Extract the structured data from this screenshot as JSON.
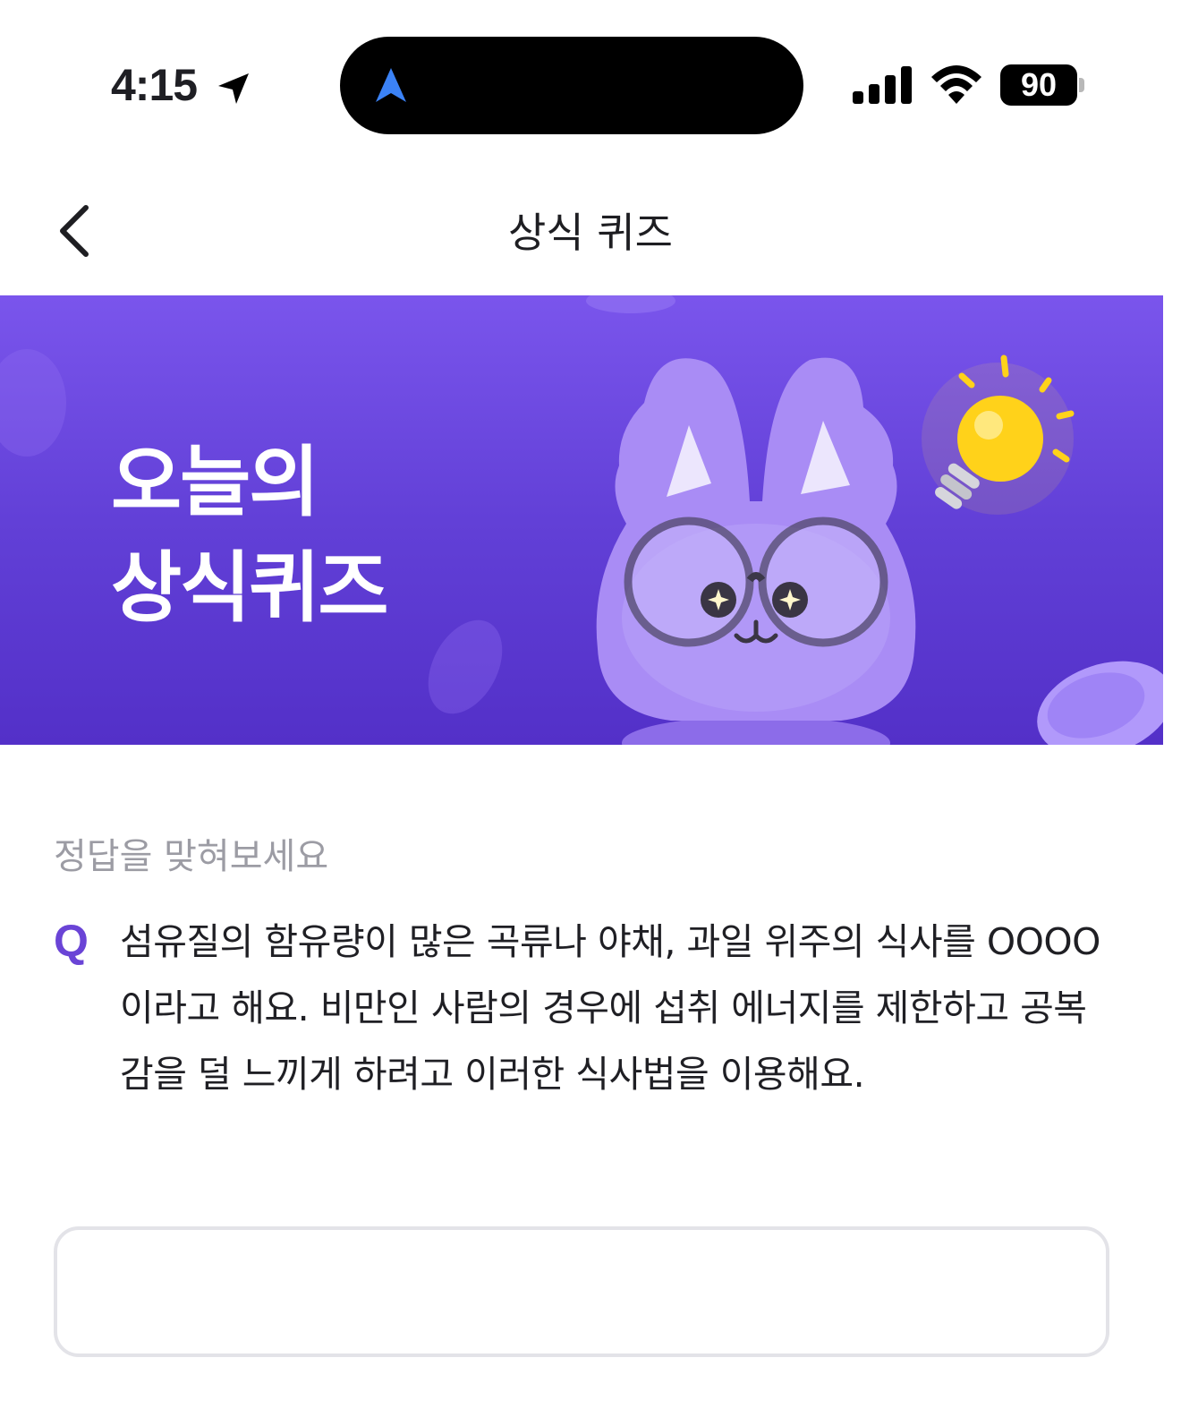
{
  "status_bar": {
    "time": "4:15",
    "battery": "90"
  },
  "nav": {
    "title": "상식 퀴즈"
  },
  "banner": {
    "title_line1": "오늘의",
    "title_line2": "상식퀴즈"
  },
  "quiz": {
    "prompt": "정답을 맞혀보세요",
    "q_mark": "Q",
    "question": "섬유질의 함유량이 많은 곡류나 야채, 과일 위주의 식사를 OOOO이라고 해요. 비만인 사람의 경우에 섭취 에너지를 제한하고 공복감을 덜 느끼게 하려고 이러한 식사법을 이용해요.",
    "answer_value": ""
  },
  "colors": {
    "accent": "#6a44d6",
    "banner_top": "#7a55ec",
    "banner_bottom": "#5330c8"
  }
}
